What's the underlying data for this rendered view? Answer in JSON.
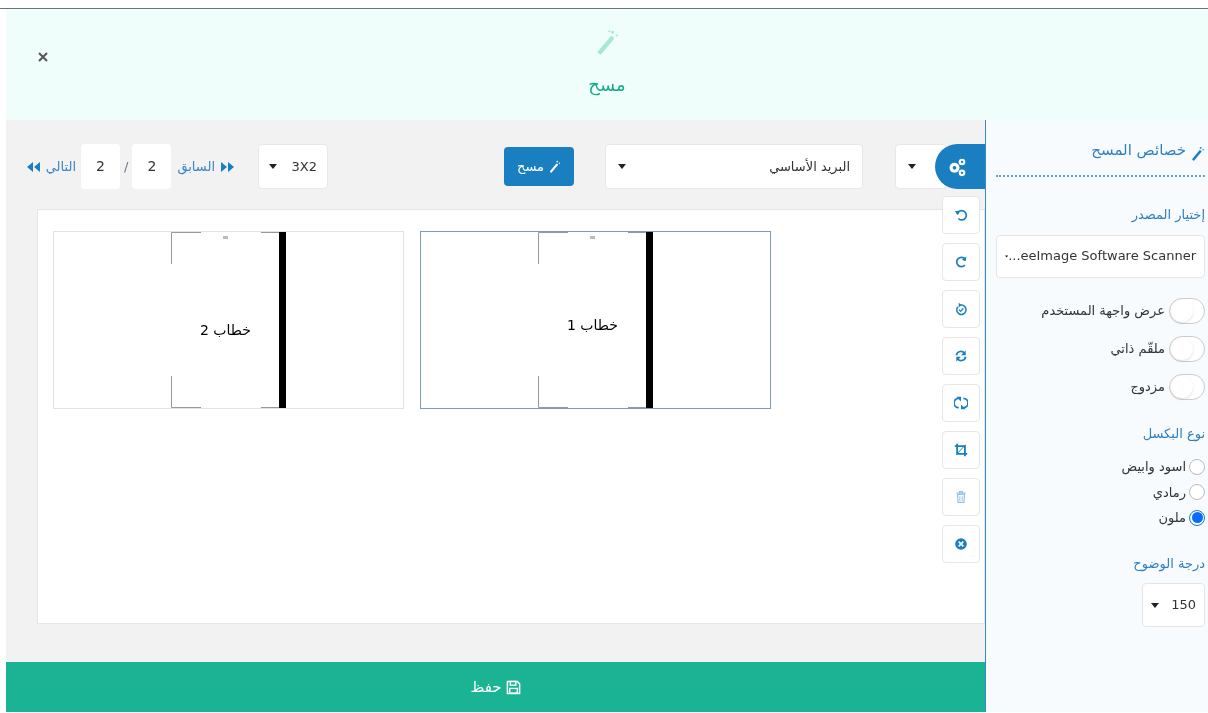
{
  "dialog": {
    "title": "مسح"
  },
  "toolbar": {
    "mailbox_value": "البريد الأساسي",
    "scan_label": "مسح",
    "layout_value": "3X2"
  },
  "pager": {
    "previous_label": "السابق",
    "current_page": "2",
    "separator": "/",
    "total_pages": "2",
    "next_label": "التالي"
  },
  "tools": [
    {
      "kind": "rotate-left",
      "disabled": false
    },
    {
      "kind": "rotate-right",
      "disabled": false
    },
    {
      "kind": "rotate-check",
      "disabled": false
    },
    {
      "kind": "refresh",
      "disabled": false
    },
    {
      "kind": "sync",
      "disabled": false
    },
    {
      "kind": "crop",
      "disabled": false
    },
    {
      "kind": "trash",
      "disabled": true
    },
    {
      "kind": "remove",
      "disabled": false
    }
  ],
  "pages": [
    {
      "text": "خطاب 1",
      "selected": true
    },
    {
      "text": "خطاب 2",
      "selected": false
    }
  ],
  "properties": {
    "title": "خصائص المسح",
    "source_label": "إختيار المصدر",
    "source_value": "...eeImage Software Scanner",
    "toggles": [
      {
        "label": "عرض واجهة المستخدم",
        "on": false
      },
      {
        "label": "ملقّم ذاتي",
        "on": false
      },
      {
        "label": "مزدوج",
        "on": false
      }
    ],
    "pixel_type_label": "نوع البكسل",
    "pixel_types": [
      {
        "label": "اسود وابيض",
        "selected": false
      },
      {
        "label": "رمادي",
        "selected": false
      },
      {
        "label": "ملون",
        "selected": true
      }
    ],
    "resolution_label": "درجة الوضوح",
    "resolution_value": "150"
  },
  "save_button": {
    "label": "حفظ"
  }
}
